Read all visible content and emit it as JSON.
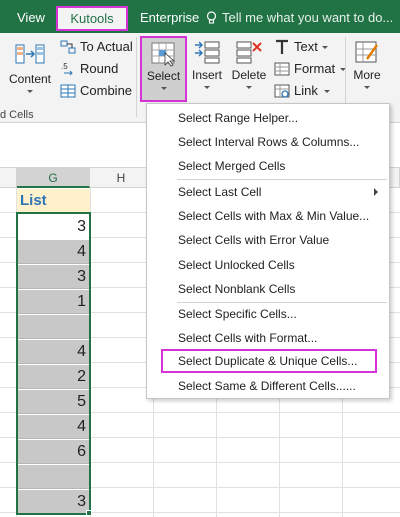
{
  "tabs": {
    "view": "View",
    "kutools": "Kutools",
    "enterprise": "Enterprise",
    "tell_me": "Tell me what you want to do..."
  },
  "ribbon": {
    "content": "Content",
    "to_actual": "To Actual",
    "round": "Round",
    "combine": "Combine",
    "select": "Select",
    "insert": "Insert",
    "delete": "Delete",
    "text": "Text",
    "format": "Format",
    "link": "Link",
    "more": "More",
    "group_label": "d Cells"
  },
  "sheet": {
    "col_g": "G",
    "col_h": "H",
    "header": "List",
    "values": [
      "3",
      "4",
      "3",
      "1",
      "",
      "4",
      "2",
      "5",
      "4",
      "6",
      "",
      "3"
    ]
  },
  "menu": {
    "items": [
      "Select Range Helper...",
      "Select Interval Rows & Columns...",
      "Select Merged Cells",
      "Select Last Cell",
      "Select Cells with Max & Min Value...",
      "Select Cells with Error Value",
      "Select Unlocked Cells",
      "Select Nonblank Cells",
      "Select Specific Cells...",
      "Select Cells with Format...",
      "Select Duplicate & Unique Cells...",
      "Select Same & Different Cells......"
    ]
  },
  "colors": {
    "accent": "#217346",
    "highlight": "#d633d6"
  }
}
